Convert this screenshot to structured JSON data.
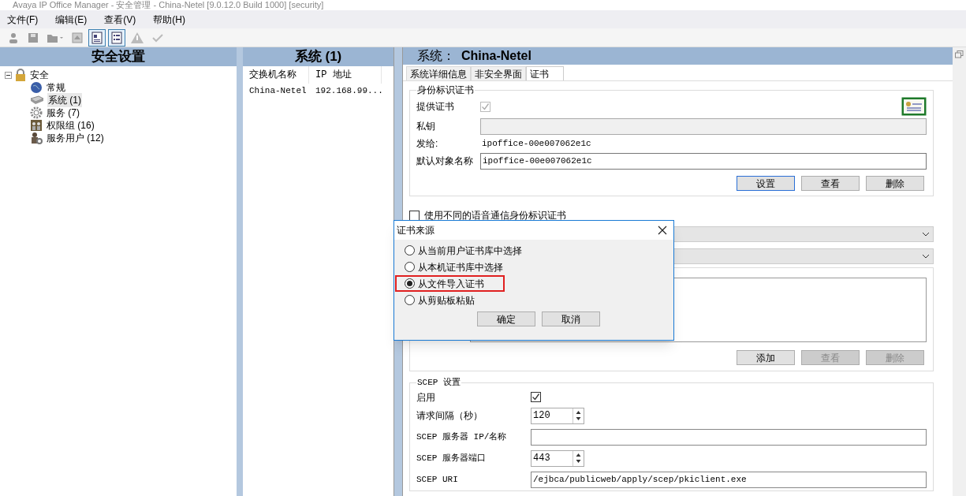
{
  "window": {
    "title": "Avaya IP Office Manager - 安全管理 - China-Netel [9.0.12.0 Build 1000] [security]"
  },
  "menu": [
    "文件(F)",
    "编辑(E)",
    "查看(V)",
    "帮助(H)"
  ],
  "toolbar": [
    {
      "kind": "user",
      "pressed": false
    },
    {
      "kind": "save",
      "pressed": false
    },
    {
      "kind": "open",
      "pressed": false
    },
    {
      "kind": "up",
      "pressed": false
    },
    {
      "kind": "details",
      "pressed": true
    },
    {
      "kind": "list",
      "pressed": true
    },
    {
      "kind": "warning",
      "pressed": false
    },
    {
      "kind": "check",
      "pressed": false
    }
  ],
  "left_panel": {
    "title": "安全设置",
    "tree": [
      {
        "label": "安全",
        "kind": "lock",
        "expanded": true,
        "selected": false,
        "children": [
          {
            "label": "常规",
            "kind": "globe",
            "selected": false
          },
          {
            "label": "系统 (1)",
            "kind": "device",
            "selected": true
          },
          {
            "label": "服务 (7)",
            "kind": "gear",
            "selected": false
          },
          {
            "label": "权限组 (16)",
            "kind": "group",
            "selected": false
          },
          {
            "label": "服务用户 (12)",
            "kind": "user",
            "selected": false
          }
        ]
      }
    ]
  },
  "middle_panel": {
    "title": "系统 (1)",
    "columns": [
      "交换机名称",
      "IP 地址"
    ],
    "rows": [
      [
        "China-Netel",
        "192.168.99..."
      ]
    ]
  },
  "right_panel": {
    "title_label": "系统：",
    "title_value": "China-Netel",
    "tabs": [
      {
        "label": "系统详细信息",
        "selected": false
      },
      {
        "label": "非安全界面",
        "selected": false
      },
      {
        "label": "证书",
        "selected": true
      }
    ],
    "identity": {
      "legend": "身份标识证书",
      "provide_label": "提供证书",
      "provide_checked": true,
      "private_key_label": "私钥",
      "issued_label": "发给:",
      "issued_value": "ipoffice-00e007062e1c",
      "subject_label": "默认对象名称",
      "subject_value": "ipoffice-00e007062e1c",
      "buttons": [
        {
          "label": "设置",
          "default": true,
          "disabled": false
        },
        {
          "label": "查看",
          "default": false,
          "disabled": false
        },
        {
          "label": "删除",
          "default": false,
          "disabled": false
        }
      ]
    },
    "voice_checkbox": {
      "label": "使用不同的语音通信身份标识证书",
      "checked": false
    },
    "trusted": {
      "buttons": [
        {
          "label": "添加",
          "default": false,
          "disabled": false
        },
        {
          "label": "查看",
          "default": false,
          "disabled": true
        },
        {
          "label": "删除",
          "default": false,
          "disabled": true
        }
      ]
    },
    "scep": {
      "legend": "SCEP 设置",
      "enable_label": "启用",
      "enable_checked": true,
      "interval_label": "请求间隔（秒）",
      "interval_value": "120",
      "server_label": "SCEP 服务器 IP/名称",
      "port_label": "SCEP 服务器端口",
      "port_value": "443",
      "uri_label": "SCEP URI",
      "uri_value": "/ejbca/publicweb/apply/scep/pkiclient.exe"
    }
  },
  "dialog": {
    "title": "证书来源",
    "options": [
      {
        "label": "从当前用户证书库中选择",
        "selected": false,
        "highlighted": false
      },
      {
        "label": "从本机证书库中选择",
        "selected": false,
        "highlighted": false
      },
      {
        "label": "从文件导入证书",
        "selected": true,
        "highlighted": true
      },
      {
        "label": "从剪贴板粘贴",
        "selected": false,
        "highlighted": false
      }
    ],
    "buttons": [
      "确定",
      "取消"
    ]
  }
}
